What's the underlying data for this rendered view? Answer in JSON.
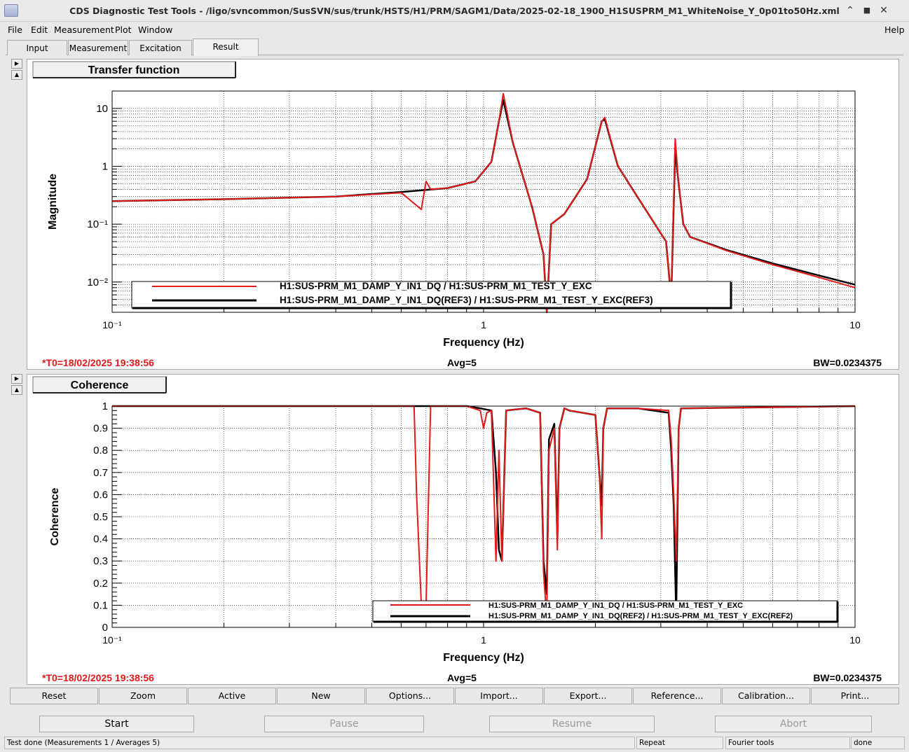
{
  "window": {
    "title": "CDS Diagnostic Test Tools - /ligo/svncommon/SusSVN/sus/trunk/HSTS/H1/PRM/SAGM1/Data/2025-02-18_1900_H1SUSPRM_M1_WhiteNoise_Y_0p01to50Hz.xml",
    "minimize": "⌃",
    "maximize": "■",
    "close": "✕"
  },
  "menubar": {
    "file": "File",
    "edit": "Edit",
    "measurement": "Measurement",
    "plot": "Plot",
    "window": "Window",
    "help": "Help"
  },
  "tabs": [
    "Input",
    "Measurement",
    "Excitation",
    "Result"
  ],
  "active_tab": "Result",
  "plot1": {
    "panel_title": "Transfer function",
    "ylabel": "Magnitude",
    "xlabel": "Frequency (Hz)",
    "xticks": [
      "10⁻¹",
      "1",
      "10"
    ],
    "yticks": [
      "10",
      "1",
      "10⁻¹",
      "10⁻²"
    ],
    "legend": [
      "H1:SUS-PRM_M1_DAMP_Y_IN1_DQ / H1:SUS-PRM_M1_TEST_Y_EXC",
      "H1:SUS-PRM_M1_DAMP_Y_IN1_DQ(REF3) / H1:SUS-PRM_M1_TEST_Y_EXC(REF3)"
    ],
    "t0": "*T0=18/02/2025 19:38:56",
    "avg": "Avg=5",
    "bw": "BW=0.0234375"
  },
  "plot2": {
    "panel_title": "Coherence",
    "ylabel": "Coherence",
    "xlabel": "Frequency (Hz)",
    "xticks": [
      "10⁻¹",
      "1",
      "10"
    ],
    "yticks": [
      "1",
      "0.9",
      "0.8",
      "0.7",
      "0.6",
      "0.5",
      "0.4",
      "0.3",
      "0.2",
      "0.1",
      "0"
    ],
    "legend": [
      "H1:SUS-PRM_M1_DAMP_Y_IN1_DQ / H1:SUS-PRM_M1_TEST_Y_EXC",
      "H1:SUS-PRM_M1_DAMP_Y_IN1_DQ(REF2) / H1:SUS-PRM_M1_TEST_Y_EXC(REF2)"
    ],
    "t0": "*T0=18/02/2025 19:38:56",
    "avg": "Avg=5",
    "bw": "BW=0.0234375"
  },
  "toolbar": [
    "Reset",
    "Zoom",
    "Active",
    "New",
    "Options...",
    "Import...",
    "Export...",
    "Reference...",
    "Calibration...",
    "Print..."
  ],
  "controls": {
    "start": "Start",
    "pause": "Pause",
    "resume": "Resume",
    "abort": "Abort"
  },
  "status": {
    "message": "Test done (Measurements 1 / Averages 5)",
    "repeat": "Repeat",
    "fourier": "Fourier tools",
    "state": "done"
  },
  "colors": {
    "series_live": "#e41a1a",
    "series_ref": "#000000",
    "annotation": "#e41a1a"
  },
  "chart_data": [
    {
      "type": "line",
      "title": "Transfer function",
      "xlabel": "Frequency (Hz)",
      "ylabel": "Magnitude",
      "x_scale": "log",
      "y_scale": "log",
      "xlim": [
        0.1,
        10
      ],
      "ylim": [
        0.003,
        20
      ],
      "grid": true,
      "legend_position": "bottom-right",
      "series": [
        {
          "name": "H1:SUS-PRM_M1_DAMP_Y_IN1_DQ / H1:SUS-PRM_M1_TEST_Y_EXC",
          "x": [
            0.1,
            0.2,
            0.4,
            0.6,
            0.68,
            0.7,
            0.72,
            0.8,
            0.95,
            1.05,
            1.1,
            1.13,
            1.2,
            1.35,
            1.45,
            1.48,
            1.52,
            1.65,
            1.9,
            2.08,
            2.12,
            2.3,
            2.7,
            3.1,
            3.2,
            3.28,
            3.35,
            3.45,
            3.6,
            4.5,
            6,
            8,
            10
          ],
          "y": [
            0.25,
            0.27,
            0.3,
            0.35,
            0.18,
            0.55,
            0.4,
            0.42,
            0.55,
            1.2,
            6,
            18,
            2.5,
            0.2,
            0.03,
            0.003,
            0.1,
            0.15,
            0.6,
            6,
            7,
            1.0,
            0.2,
            0.05,
            0.005,
            3,
            0.5,
            0.1,
            0.06,
            0.035,
            0.02,
            0.012,
            0.008
          ]
        },
        {
          "name": "H1:SUS-PRM_M1_DAMP_Y_IN1_DQ(REF3) / H1:SUS-PRM_M1_TEST_Y_EXC(REF3)",
          "x": [
            0.1,
            0.2,
            0.4,
            0.6,
            0.8,
            0.95,
            1.05,
            1.1,
            1.13,
            1.2,
            1.35,
            1.45,
            1.48,
            1.52,
            1.65,
            1.9,
            2.08,
            2.12,
            2.3,
            2.7,
            3.1,
            3.2,
            3.28,
            3.35,
            3.45,
            3.6,
            4.5,
            6,
            8,
            10
          ],
          "y": [
            0.25,
            0.27,
            0.3,
            0.36,
            0.42,
            0.55,
            1.2,
            6,
            14,
            2.5,
            0.2,
            0.03,
            0.003,
            0.1,
            0.15,
            0.6,
            6,
            6.5,
            1.0,
            0.2,
            0.05,
            0.005,
            2,
            0.5,
            0.1,
            0.06,
            0.036,
            0.021,
            0.013,
            0.009
          ]
        }
      ]
    },
    {
      "type": "line",
      "title": "Coherence",
      "xlabel": "Frequency (Hz)",
      "ylabel": "Coherence",
      "x_scale": "log",
      "y_scale": "linear",
      "xlim": [
        0.1,
        10
      ],
      "ylim": [
        0,
        1
      ],
      "grid": true,
      "legend_position": "bottom-right",
      "series": [
        {
          "name": "H1:SUS-PRM_M1_DAMP_Y_IN1_DQ / H1:SUS-PRM_M1_TEST_Y_EXC",
          "x": [
            0.1,
            0.65,
            0.66,
            0.68,
            0.7,
            0.72,
            0.9,
            0.98,
            1.0,
            1.02,
            1.05,
            1.08,
            1.1,
            1.12,
            1.15,
            1.3,
            1.42,
            1.45,
            1.48,
            1.5,
            1.55,
            1.58,
            1.6,
            1.65,
            1.7,
            2.0,
            2.05,
            2.08,
            2.1,
            2.15,
            2.6,
            3.15,
            3.2,
            3.25,
            3.3,
            3.35,
            3.4,
            10
          ],
          "y": [
            1,
            1,
            0.6,
            0.1,
            0.1,
            1,
            1,
            0.98,
            0.9,
            0.97,
            0.98,
            0.3,
            0.8,
            0.3,
            0.98,
            0.99,
            0.97,
            0.25,
            0.04,
            0.8,
            0.9,
            0.35,
            0.9,
            0.99,
            0.98,
            0.96,
            0.7,
            0.4,
            0.9,
            0.99,
            0.99,
            0.98,
            0.85,
            0.6,
            0.3,
            0.9,
            0.99,
            1
          ]
        },
        {
          "name": "H1:SUS-PRM_M1_DAMP_Y_IN1_DQ(REF2) / H1:SUS-PRM_M1_TEST_Y_EXC(REF2)",
          "x": [
            0.1,
            0.9,
            0.98,
            1.05,
            1.08,
            1.1,
            1.12,
            1.15,
            1.3,
            1.42,
            1.45,
            1.48,
            1.5,
            1.55,
            1.58,
            1.6,
            1.65,
            1.7,
            2.0,
            2.05,
            2.08,
            2.1,
            2.15,
            2.6,
            3.15,
            3.2,
            3.25,
            3.3,
            3.35,
            3.4,
            10
          ],
          "y": [
            1,
            1,
            0.99,
            0.98,
            0.7,
            0.35,
            0.3,
            0.98,
            0.99,
            0.97,
            0.3,
            0.15,
            0.85,
            0.92,
            0.4,
            0.9,
            0.99,
            0.98,
            0.96,
            0.7,
            0.55,
            0.9,
            0.99,
            0.99,
            0.97,
            0.8,
            0.55,
            0.05,
            0.9,
            0.99,
            1
          ]
        }
      ]
    }
  ]
}
